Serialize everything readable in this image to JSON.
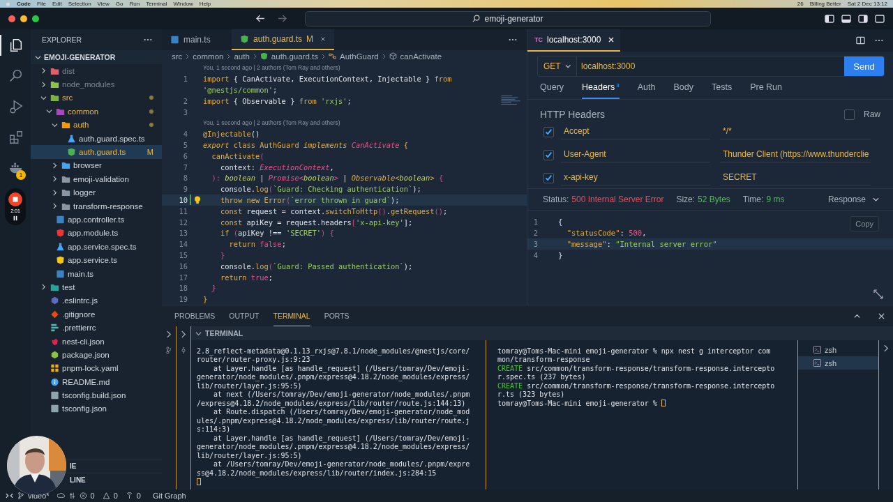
{
  "menubar": {
    "app": "Code",
    "menus": [
      "File",
      "Edit",
      "Selection",
      "View",
      "Go",
      "Run",
      "Terminal",
      "Window",
      "Help"
    ],
    "status_items": [
      "26",
      "Billing Better",
      "Sat 2 Dec 13:12"
    ]
  },
  "title_bar": {
    "search": "emoji-generator"
  },
  "activity_bar": {
    "items": [
      {
        "kind": "explorer",
        "selected": true
      },
      {
        "kind": "search",
        "selected": false
      },
      {
        "kind": "run",
        "selected": false
      },
      {
        "kind": "extensions",
        "selected": false
      },
      {
        "kind": "docker",
        "selected": false,
        "badge": "1"
      }
    ],
    "recorder": {
      "time": "2:01"
    }
  },
  "explorer": {
    "title": "EXPLORER",
    "root": "EMOJI-GENERATOR",
    "sections": [
      "IE",
      "LINE"
    ],
    "items": [
      {
        "name": "dist",
        "kind": "folder",
        "color": "#e0606a",
        "ignored": true,
        "modified": false,
        "expanded": false,
        "selected": false
      },
      {
        "name": "node_modules",
        "kind": "folder",
        "color": "#8bc34a",
        "ignored": true,
        "modified": false,
        "expanded": false,
        "selected": false
      },
      {
        "name": "src",
        "kind": "folder",
        "color": "#7cb342",
        "ignored": false,
        "modified": true,
        "expanded": true,
        "selected": false,
        "children": [
          {
            "name": "common",
            "kind": "folder",
            "color": "#ab47bc",
            "ignored": false,
            "modified": true,
            "expanded": true,
            "selected": false,
            "children": [
              {
                "name": "auth",
                "kind": "folder",
                "color": "#ff9800",
                "ignored": false,
                "modified": true,
                "expanded": true,
                "selected": false,
                "children": [
                  {
                    "name": "auth.guard.spec.ts",
                    "kind": "test",
                    "color": "#42a5f5",
                    "ignored": false,
                    "modified": false,
                    "selected": false
                  },
                  {
                    "name": "auth.guard.ts",
                    "kind": "angular",
                    "color": "#4caf50",
                    "ignored": false,
                    "modified": true,
                    "badge": "M",
                    "selected": true
                  }
                ]
              },
              {
                "name": "browser",
                "kind": "folder",
                "color": "#42a5f5",
                "ignored": false,
                "modified": false,
                "expanded": false,
                "selected": false
              },
              {
                "name": "emoji-validation",
                "kind": "folder",
                "color": "#8a96a3",
                "ignored": false,
                "modified": false,
                "expanded": false,
                "selected": false
              },
              {
                "name": "logger",
                "kind": "folder",
                "color": "#8a96a3",
                "ignored": false,
                "modified": false,
                "expanded": false,
                "selected": false
              },
              {
                "name": "transform-response",
                "kind": "folder",
                "color": "#8a96a3",
                "ignored": false,
                "modified": false,
                "expanded": false,
                "selected": false
              }
            ]
          },
          {
            "name": "app.controller.ts",
            "kind": "ts",
            "color": "#3b82c4",
            "ignored": false,
            "modified": false,
            "selected": false
          },
          {
            "name": "app.module.ts",
            "kind": "angular",
            "color": "#e53935",
            "ignored": false,
            "modified": false,
            "selected": false
          },
          {
            "name": "app.service.spec.ts",
            "kind": "test",
            "color": "#42a5f5",
            "ignored": false,
            "modified": false,
            "selected": false
          },
          {
            "name": "app.service.ts",
            "kind": "angular",
            "color": "#f5c518",
            "ignored": false,
            "modified": false,
            "selected": false
          },
          {
            "name": "main.ts",
            "kind": "ts",
            "color": "#3b82c4",
            "ignored": false,
            "modified": false,
            "selected": false
          }
        ]
      },
      {
        "name": "test",
        "kind": "folder",
        "color": "#26a69a",
        "ignored": false,
        "modified": false,
        "expanded": false,
        "selected": false
      },
      {
        "name": ".eslintrc.js",
        "kind": "eslint",
        "color": "#5c6bc0",
        "ignored": false,
        "modified": false,
        "selected": false
      },
      {
        "name": ".gitignore",
        "kind": "git",
        "color": "#e64a19",
        "ignored": false,
        "modified": false,
        "selected": false
      },
      {
        "name": ".prettierrc",
        "kind": "prettier",
        "color": "#56b3b4",
        "ignored": false,
        "modified": false,
        "selected": false
      },
      {
        "name": "nest-cli.json",
        "kind": "nest",
        "color": "#e0234e",
        "ignored": false,
        "modified": false,
        "selected": false
      },
      {
        "name": "package.json",
        "kind": "node",
        "color": "#8bc34a",
        "ignored": false,
        "modified": false,
        "selected": false
      },
      {
        "name": "pnpm-lock.yaml",
        "kind": "yaml",
        "color": "#f9ad00",
        "ignored": false,
        "modified": false,
        "selected": false
      },
      {
        "name": "README.md",
        "kind": "info",
        "color": "#42a5f5",
        "ignored": false,
        "modified": false,
        "selected": false
      },
      {
        "name": "tsconfig.build.json",
        "kind": "tsconfig",
        "color": "#90a4ae",
        "ignored": false,
        "modified": false,
        "selected": false
      },
      {
        "name": "tsconfig.json",
        "kind": "tsconfig",
        "color": "#90a4ae",
        "ignored": false,
        "modified": false,
        "selected": false
      }
    ]
  },
  "editor": {
    "tabs": [
      {
        "label": "main.ts",
        "kind": "ts",
        "selected": false
      },
      {
        "label": "auth.guard.ts",
        "kind": "angular",
        "badge": "M",
        "selected": true
      }
    ],
    "breadcrumbs": [
      {
        "label": "src",
        "kind": "plain"
      },
      {
        "label": "common",
        "kind": "plain"
      },
      {
        "label": "auth",
        "kind": "plain"
      },
      {
        "label": "auth.guard.ts",
        "kind": "angular"
      },
      {
        "label": "AuthGuard",
        "kind": "class"
      },
      {
        "label": "canActivate",
        "kind": "method"
      }
    ],
    "lines": [
      {
        "kind": "blame",
        "text": "You, 1 second ago | 2 authors (Tom Ray and others)"
      },
      {
        "kind": "code",
        "num": "1",
        "current": false,
        "tokens": [
          {
            "text": "import",
            "kind": "kw"
          },
          {
            "text": " { CanActivate, ExecutionContext, Injectable } ",
            "kind": "id"
          },
          {
            "text": "from",
            "kind": "kw"
          }
        ]
      },
      {
        "kind": "code",
        "current": false,
        "tokens": [
          {
            "text": "'@nestjs/common'",
            "kind": "str"
          },
          {
            "text": ";",
            "kind": "id"
          }
        ]
      },
      {
        "kind": "code",
        "num": "2",
        "current": false,
        "tokens": [
          {
            "text": "import",
            "kind": "kw"
          },
          {
            "text": " { Observable } ",
            "kind": "id"
          },
          {
            "text": "from",
            "kind": "kw"
          },
          {
            "text": " 'rxjs'",
            "kind": "str"
          },
          {
            "text": ";",
            "kind": "id"
          }
        ]
      },
      {
        "kind": "code",
        "num": "3",
        "current": false
      },
      {
        "kind": "blame",
        "text": "You, 1 second ago | 2 authors (Tom Ray and others)"
      },
      {
        "kind": "code",
        "num": "4",
        "current": false,
        "tokens": [
          {
            "text": "@Injectable",
            "kind": "fn"
          },
          {
            "text": "()",
            "kind": "id"
          }
        ]
      },
      {
        "kind": "code",
        "num": "5",
        "current": false,
        "tokens": [
          {
            "text": "export",
            "kind": "kwi"
          },
          {
            "text": " class ",
            "kind": "kw"
          },
          {
            "text": "AuthGuard",
            "kind": "fn"
          },
          {
            "text": " implements ",
            "kind": "kwi"
          },
          {
            "text": "CanActivate",
            "kind": "type"
          },
          {
            "text": " {",
            "kind": "fn"
          }
        ]
      },
      {
        "kind": "code",
        "num": "6",
        "current": false,
        "tokens": [
          {
            "text": "  canActivate",
            "kind": "fn"
          },
          {
            "text": "(",
            "kind": "punc"
          }
        ]
      },
      {
        "kind": "code",
        "num": "7",
        "current": false,
        "tokens": [
          {
            "text": "    context: ",
            "kind": "id"
          },
          {
            "text": "ExecutionContext",
            "kind": "type"
          },
          {
            "text": ",",
            "kind": "id"
          }
        ]
      },
      {
        "kind": "code",
        "num": "8",
        "current": false,
        "tokens": [
          {
            "text": "  ): ",
            "kind": "punc"
          },
          {
            "text": "boolean",
            "kind": "prim"
          },
          {
            "text": " | ",
            "kind": "id"
          },
          {
            "text": "Promise<",
            "kind": "type"
          },
          {
            "text": "boolean",
            "kind": "prim"
          },
          {
            "text": ">",
            "kind": "type"
          },
          {
            "text": " | ",
            "kind": "id"
          },
          {
            "text": "Observable<",
            "kind": "kwi"
          },
          {
            "text": "boolean",
            "kind": "prim"
          },
          {
            "text": ">",
            "kind": "kwi"
          },
          {
            "text": " {",
            "kind": "punc"
          }
        ]
      },
      {
        "kind": "code",
        "num": "9",
        "current": false,
        "tokens": [
          {
            "text": "    console.",
            "kind": "id"
          },
          {
            "text": "log",
            "kind": "fn"
          },
          {
            "text": "(",
            "kind": "punc"
          },
          {
            "text": "`Guard: Checking authentication`",
            "kind": "str"
          },
          {
            "text": ");",
            "kind": "id"
          }
        ]
      },
      {
        "kind": "code",
        "num": "10",
        "current": true,
        "tokens": [
          {
            "text": "    throw new ",
            "kind": "kw"
          },
          {
            "text": "Error",
            "kind": "fn"
          },
          {
            "text": "(",
            "kind": "punc"
          },
          {
            "text": "`error thrown in guard`",
            "kind": "str"
          },
          {
            "text": ");",
            "kind": "id"
          }
        ]
      },
      {
        "kind": "code",
        "num": "11",
        "current": false,
        "tokens": [
          {
            "text": "    const",
            "kind": "kw"
          },
          {
            "text": " request = context.",
            "kind": "id"
          },
          {
            "text": "switchToHttp",
            "kind": "fn"
          },
          {
            "text": "()",
            "kind": "punc"
          },
          {
            "text": ".",
            "kind": "id"
          },
          {
            "text": "getRequest",
            "kind": "fn"
          },
          {
            "text": "()",
            "kind": "punc"
          },
          {
            "text": ";",
            "kind": "id"
          }
        ]
      },
      {
        "kind": "code",
        "num": "12",
        "current": false,
        "tokens": [
          {
            "text": "    const",
            "kind": "kw"
          },
          {
            "text": " apiKey = request.headers",
            "kind": "id"
          },
          {
            "text": "[",
            "kind": "punc"
          },
          {
            "text": "'x-api-key'",
            "kind": "str"
          },
          {
            "text": "];",
            "kind": "id"
          }
        ]
      },
      {
        "kind": "code",
        "num": "13",
        "current": false,
        "tokens": [
          {
            "text": "    if",
            "kind": "kw"
          },
          {
            "text": " (",
            "kind": "punc"
          },
          {
            "text": "apiKey !== ",
            "kind": "id"
          },
          {
            "text": "'SECRET'",
            "kind": "str"
          },
          {
            "text": ") {",
            "kind": "punc"
          }
        ]
      },
      {
        "kind": "code",
        "num": "14",
        "current": false,
        "tokens": [
          {
            "text": "      return",
            "kind": "kw"
          },
          {
            "text": " false",
            "kind": "num"
          },
          {
            "text": ";",
            "kind": "id"
          }
        ]
      },
      {
        "kind": "code",
        "num": "15",
        "current": false,
        "tokens": [
          {
            "text": "    }",
            "kind": "punc"
          }
        ]
      },
      {
        "kind": "code",
        "num": "16",
        "current": false,
        "tokens": [
          {
            "text": "    console.",
            "kind": "id"
          },
          {
            "text": "log",
            "kind": "fn"
          },
          {
            "text": "(",
            "kind": "punc"
          },
          {
            "text": "`Guard: Passed authentication`",
            "kind": "str"
          },
          {
            "text": ");",
            "kind": "id"
          }
        ]
      },
      {
        "kind": "code",
        "num": "17",
        "current": false,
        "tokens": [
          {
            "text": "    return",
            "kind": "kw"
          },
          {
            "text": " true",
            "kind": "num"
          },
          {
            "text": ";",
            "kind": "id"
          }
        ]
      },
      {
        "kind": "code",
        "num": "18",
        "current": false,
        "tokens": [
          {
            "text": "  }",
            "kind": "type"
          }
        ]
      },
      {
        "kind": "code",
        "num": "19",
        "current": false,
        "tokens": [
          {
            "text": "}",
            "kind": "fn"
          }
        ]
      }
    ]
  },
  "thunder": {
    "tab": {
      "badge": "TC",
      "label": "localhost:3000"
    },
    "method": "GET",
    "url": "localhost:3000",
    "send": "Send",
    "tabs": [
      {
        "label": "Query",
        "selected": false
      },
      {
        "label": "Headers",
        "count": "3",
        "selected": true
      },
      {
        "label": "Auth",
        "selected": false
      },
      {
        "label": "Body",
        "selected": false
      },
      {
        "label": "Tests",
        "selected": false
      },
      {
        "label": "Pre Run",
        "selected": false
      }
    ],
    "headers_title": "HTTP Headers",
    "raw": {
      "label": "Raw",
      "checked": false
    },
    "headers": [
      {
        "name": "Accept",
        "value": "*/*",
        "checked": true
      },
      {
        "name": "User-Agent",
        "value": "Thunder Client (https://www.thunderclie",
        "checked": true
      },
      {
        "name": "x-api-key",
        "value": "SECRET",
        "checked": true
      }
    ],
    "status": {
      "label": "Status:",
      "value": "500 Internal Server Error"
    },
    "size": {
      "label": "Size:",
      "value": "52 Bytes"
    },
    "time": {
      "label": "Time:",
      "value": "9 ms"
    },
    "response_menu": "Response",
    "copy": "Copy",
    "response_lines": [
      {
        "num": "1",
        "current": false,
        "tokens": [
          {
            "text": "{",
            "kind": "id"
          }
        ]
      },
      {
        "num": "2",
        "current": false,
        "tokens": [
          {
            "text": "  \"statusCode\"",
            "kind": "fn"
          },
          {
            "text": ": ",
            "kind": "id"
          },
          {
            "text": "500",
            "kind": "num"
          },
          {
            "text": ",",
            "kind": "id"
          }
        ]
      },
      {
        "num": "3",
        "current": true,
        "tokens": [
          {
            "text": "  \"message\"",
            "kind": "fn"
          },
          {
            "text": ": ",
            "kind": "id"
          },
          {
            "text": "\"Internal server error\"",
            "kind": "str"
          }
        ]
      },
      {
        "num": "4",
        "current": false,
        "tokens": [
          {
            "text": "}",
            "kind": "id"
          }
        ]
      }
    ]
  },
  "panel": {
    "tabs": [
      {
        "label": "PROBLEMS",
        "selected": false
      },
      {
        "label": "OUTPUT",
        "selected": false
      },
      {
        "label": "TERMINAL",
        "selected": true
      },
      {
        "label": "PORTS",
        "selected": false
      }
    ],
    "terminal_title": "TERMINAL",
    "left_lines": [
      "2.8_reflect-metadata@0.1.13_rxjs@7.8.1/node_modules/@nestjs/core/",
      "router/router-proxy.js:9:23",
      "    at Layer.handle [as handle_request] (/Users/tomray/Dev/emoji-",
      "generator/node_modules/.pnpm/express@4.18.2/node_modules/express/",
      "lib/router/layer.js:95:5)",
      "    at next (/Users/tomray/Dev/emoji-generator/node_modules/.pnpm",
      "/express@4.18.2/node_modules/express/lib/router/route.js:144:13)",
      "    at Route.dispatch (/Users/tomray/Dev/emoji-generator/node_mod",
      "ules/.pnpm/express@4.18.2/node_modules/express/lib/router/route.j",
      "s:114:3)",
      "    at Layer.handle [as handle_request] (/Users/tomray/Dev/emoji-",
      "generator/node_modules/.pnpm/express@4.18.2/node_modules/express/",
      "lib/router/layer.js:95:5)",
      "    at /Users/tomray/Dev/emoji-generator/node_modules/.pnpm/expre",
      "ss@4.18.2/node_modules/express/lib/router/index.js:284:15"
    ],
    "right_lines": [
      {
        "text": "tomray@Toms-Mac-mini emoji-generator % npx nest g interceptor com"
      },
      {
        "text": "mon/transform-response"
      },
      {
        "prefix": "CREATE",
        "text": "src/common/transform-response/transform-response.intercepto"
      },
      {
        "text": "r.spec.ts (237 bytes)"
      },
      {
        "prefix": "CREATE",
        "text": "src/common/transform-response/transform-response.intercepto"
      },
      {
        "text": "r.ts (323 bytes)"
      },
      {
        "text": "tomray@Toms-Mac-mini emoji-generator %"
      }
    ],
    "shells": [
      {
        "label": "zsh",
        "selected": false
      },
      {
        "label": "zsh",
        "selected": true
      }
    ]
  },
  "status_bar": {
    "branch": "video*",
    "errors": "0",
    "warnings": "0",
    "ports": "0",
    "git_graph": "Git Graph"
  }
}
